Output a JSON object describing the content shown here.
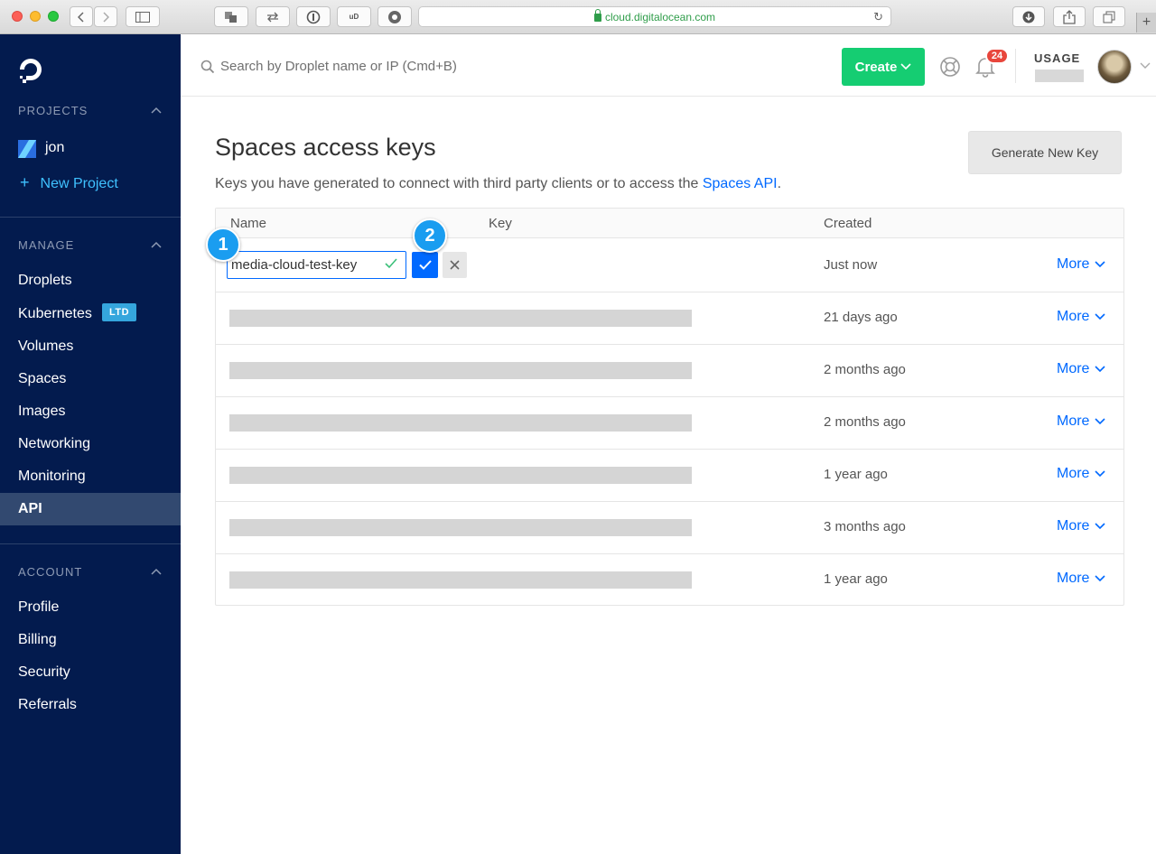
{
  "browser": {
    "url": "cloud.digitalocean.com"
  },
  "sidebar": {
    "projects_heading": "PROJECTS",
    "project_name": "jon",
    "new_project_label": "New Project",
    "manage_heading": "MANAGE",
    "manage_items": [
      {
        "label": "Droplets"
      },
      {
        "label": "Kubernetes",
        "badge": "LTD"
      },
      {
        "label": "Volumes"
      },
      {
        "label": "Spaces"
      },
      {
        "label": "Images"
      },
      {
        "label": "Networking"
      },
      {
        "label": "Monitoring"
      },
      {
        "label": "API",
        "active": true
      }
    ],
    "account_heading": "ACCOUNT",
    "account_items": [
      {
        "label": "Profile"
      },
      {
        "label": "Billing"
      },
      {
        "label": "Security"
      },
      {
        "label": "Referrals"
      }
    ]
  },
  "header": {
    "search_placeholder": "Search by Droplet name or IP (Cmd+B)",
    "create_label": "Create",
    "notification_count": "24",
    "usage_label": "USAGE"
  },
  "main": {
    "title": "Spaces access keys",
    "subtitle_prefix": "Keys you have generated to connect with third party clients or to access the ",
    "subtitle_link": "Spaces API",
    "subtitle_suffix": ".",
    "generate_button": "Generate New Key",
    "columns": {
      "name": "Name",
      "key": "Key",
      "created": "Created"
    },
    "editing_row": {
      "name_value": "media-cloud-test-key",
      "created": "Just now",
      "more_label": "More"
    },
    "rows": [
      {
        "created": "21 days ago",
        "more_label": "More"
      },
      {
        "created": "2 months ago",
        "more_label": "More"
      },
      {
        "created": "2 months ago",
        "more_label": "More"
      },
      {
        "created": "1 year ago",
        "more_label": "More"
      },
      {
        "created": "3 months ago",
        "more_label": "More"
      },
      {
        "created": "1 year ago",
        "more_label": "More"
      }
    ],
    "callouts": [
      "1",
      "2"
    ]
  },
  "colors": {
    "sidebar_bg": "#031b4e",
    "accent_blue": "#0069ff",
    "create_green": "#15cd72",
    "badge_red": "#e8463c",
    "callout_blue": "#1a9df0"
  }
}
